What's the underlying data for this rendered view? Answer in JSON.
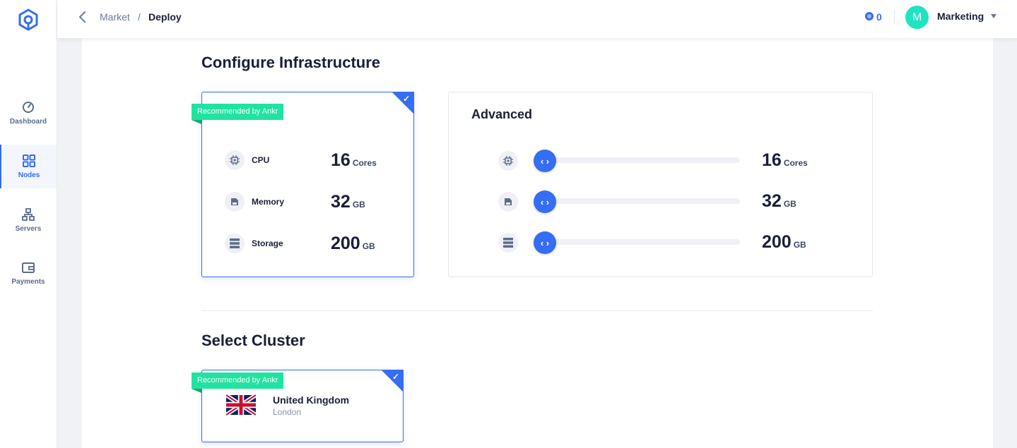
{
  "sidebar": {
    "items": [
      {
        "label": "Dashboard",
        "icon": "gauge-icon",
        "active": false
      },
      {
        "label": "Nodes",
        "icon": "grid-icon",
        "active": true
      },
      {
        "label": "Servers",
        "icon": "hierarchy-icon",
        "active": false
      },
      {
        "label": "Payments",
        "icon": "wallet-icon",
        "active": false
      }
    ]
  },
  "header": {
    "breadcrumb": {
      "parent": "Market",
      "separator": "/",
      "current": "Deploy"
    },
    "credits": "0",
    "avatar_initial": "M",
    "account_name": "Marketing"
  },
  "infrastructure": {
    "title": "Configure Infrastructure",
    "recommended": {
      "badge": "Recommended by Ankr",
      "check": "✓",
      "specs": [
        {
          "label": "CPU",
          "value": "16",
          "unit": "Cores"
        },
        {
          "label": "Memory",
          "value": "32",
          "unit": "GB"
        },
        {
          "label": "Storage",
          "value": "200",
          "unit": "GB"
        }
      ]
    },
    "advanced": {
      "title": "Advanced",
      "thumb_glyph": "‹ ›",
      "sliders": [
        {
          "icon": "cpu-icon",
          "value": "16",
          "unit": "Cores",
          "level": 0
        },
        {
          "icon": "memory-icon",
          "value": "32",
          "unit": "GB",
          "level": 0
        },
        {
          "icon": "storage-icon",
          "value": "200",
          "unit": "GB",
          "level": 0
        }
      ]
    }
  },
  "cluster": {
    "title": "Select Cluster",
    "badge": "Recommended by Ankr",
    "check": "✓",
    "country": "United Kingdom",
    "city": "London",
    "flag_icon": "uk-flag-icon"
  },
  "colors": {
    "accent": "#356df3",
    "badge_green": "#20e3a0",
    "avatar": "#20e3c1"
  }
}
